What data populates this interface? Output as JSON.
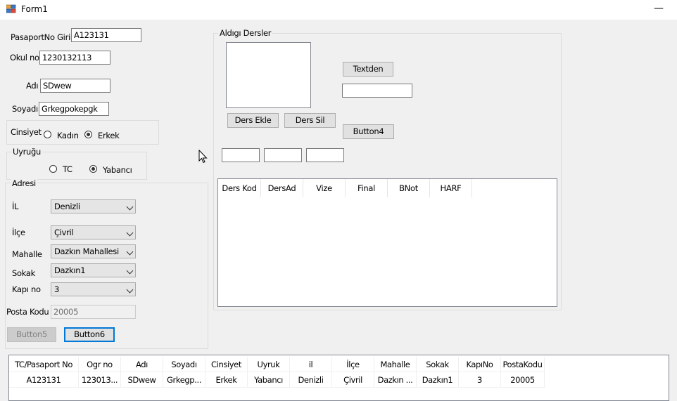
{
  "window": {
    "title": "Form1",
    "minimize_glyph": "—"
  },
  "form": {
    "pasaport_label": "PasaportNo Giriniz",
    "pasaport_value": "A123131",
    "okulno_label": "Okul no",
    "okulno_value": "1230132113",
    "adi_label": "Adı",
    "adi_value": "SDwew",
    "soyadi_label": "Soyadı",
    "soyadi_value": "Grkegpokepgk"
  },
  "cinsiyet": {
    "title": "Cinsiyet",
    "options": [
      "Kadın",
      "Erkek"
    ],
    "selected": "Erkek"
  },
  "uyrugu": {
    "title": "Uyruğu",
    "options": [
      "TC",
      "Yabancı"
    ],
    "selected": "Yabancı"
  },
  "adres": {
    "title": "Adresi",
    "il_label": "İL",
    "il_value": "Denizli",
    "ilce_label": "İlçe",
    "ilce_value": "Çivril",
    "mahalle_label": "Mahalle",
    "mahalle_value": "Dazkın Mahallesi",
    "sokak_label": "Sokak",
    "sokak_value": "Dazkın1",
    "kapino_label": "Kapı no",
    "kapino_value": "3",
    "postakodu_label": "Posta Kodu",
    "postakodu_value": "20005",
    "button5": "Button5",
    "button6": "Button6"
  },
  "dersler": {
    "title": "Aldıgı Dersler",
    "textden_button": "Textden",
    "ders_ekle_button": "Ders Ekle",
    "ders_sil_button": "Ders Sil",
    "button4": "Button4",
    "columns": [
      "Ders Kod",
      "DersAd",
      "Vize",
      "Final",
      "BNot",
      "HARF"
    ]
  },
  "grid": {
    "columns": [
      "TC/Pasaport No",
      "Ogr no",
      "Adı",
      "Soyadı",
      "Cinsiyet",
      "Uyruk",
      "il",
      "İlçe",
      "Mahalle",
      "Sokak",
      "KapıNo",
      "PostaKodu"
    ],
    "rows": [
      [
        "A123131",
        "123013...",
        "SDwew",
        "Grkegp...",
        "Erkek",
        "Yabancı",
        "Denizli",
        "Çivril",
        "Dazkın ...",
        "Dazkın1",
        "3",
        "20005"
      ]
    ]
  }
}
